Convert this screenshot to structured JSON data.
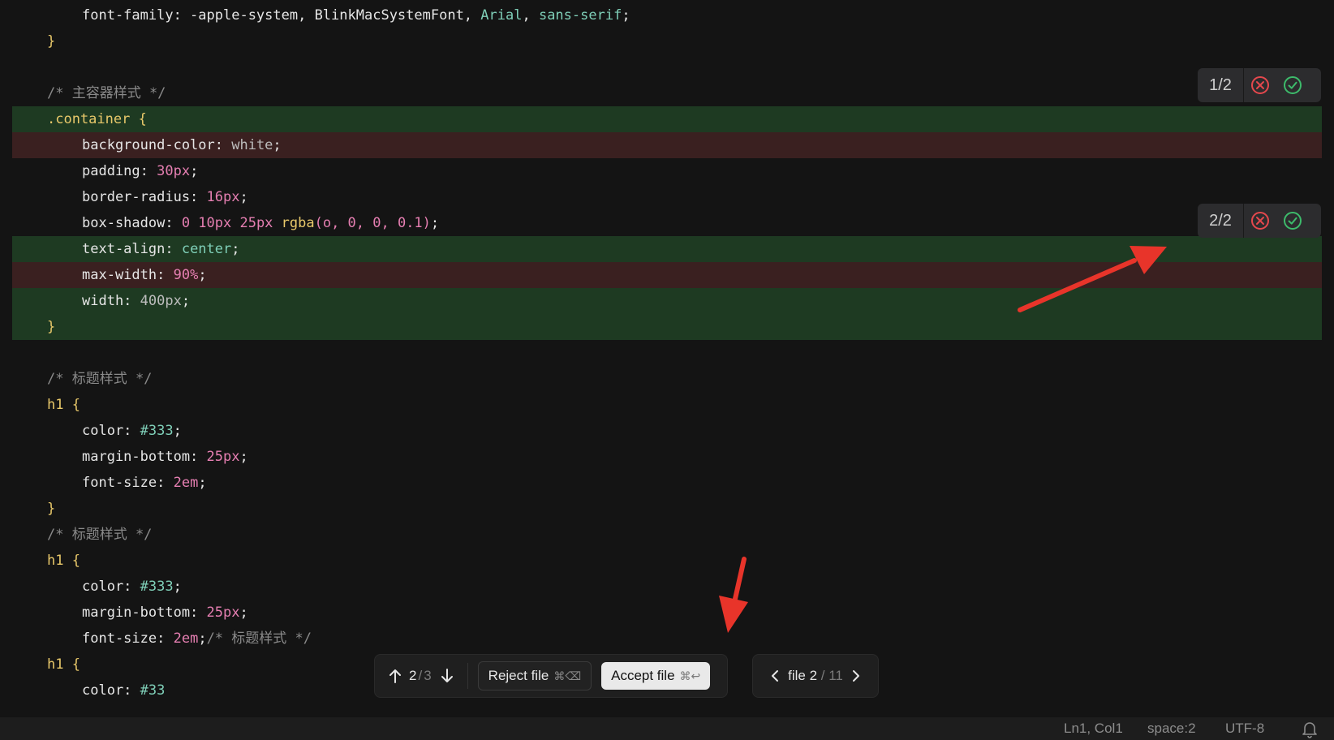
{
  "editor": {
    "lines": [
      {
        "diff": "none",
        "indent": 1,
        "tokens": [
          {
            "t": "font-family: -apple-system, BlinkMacSystemFont, ",
            "c": "prop"
          },
          {
            "t": "Arial",
            "c": "teal"
          },
          {
            "t": ", ",
            "c": "prop"
          },
          {
            "t": "sans-serif",
            "c": "teal"
          },
          {
            "t": ";",
            "c": "prop"
          }
        ]
      },
      {
        "diff": "none",
        "indent": 0,
        "tokens": [
          {
            "t": "}",
            "c": "yellow"
          }
        ]
      },
      {
        "diff": "none",
        "indent": 0,
        "tokens": []
      },
      {
        "diff": "none",
        "indent": 0,
        "tokens": [
          {
            "t": "/* 主容器样式 */",
            "c": "comment"
          }
        ]
      },
      {
        "diff": "added",
        "indent": 0,
        "tokens": [
          {
            "t": ".container {",
            "c": "sel"
          }
        ]
      },
      {
        "diff": "removed",
        "indent": 1,
        "tokens": [
          {
            "t": "background-color: ",
            "c": "prop"
          },
          {
            "t": "white",
            "c": "gray"
          },
          {
            "t": ";",
            "c": "prop"
          }
        ]
      },
      {
        "diff": "none",
        "indent": 1,
        "tokens": [
          {
            "t": "padding: ",
            "c": "prop"
          },
          {
            "t": "30px",
            "c": "pink"
          },
          {
            "t": ";",
            "c": "prop"
          }
        ]
      },
      {
        "diff": "none",
        "indent": 1,
        "tokens": [
          {
            "t": "border-radius: ",
            "c": "prop"
          },
          {
            "t": "16px",
            "c": "pink"
          },
          {
            "t": ";",
            "c": "prop"
          }
        ]
      },
      {
        "diff": "none",
        "indent": 1,
        "tokens": [
          {
            "t": "box-shadow: ",
            "c": "prop"
          },
          {
            "t": "0 10px 25px ",
            "c": "pink"
          },
          {
            "t": "rgba",
            "c": "yellow"
          },
          {
            "t": "(o, 0, 0, 0.1)",
            "c": "pink"
          },
          {
            "t": ";",
            "c": "prop"
          }
        ]
      },
      {
        "diff": "added",
        "indent": 1,
        "tokens": [
          {
            "t": "text-align: ",
            "c": "prop"
          },
          {
            "t": "center",
            "c": "teal"
          },
          {
            "t": ";",
            "c": "prop"
          }
        ]
      },
      {
        "diff": "removed",
        "indent": 1,
        "tokens": [
          {
            "t": "max-width: ",
            "c": "prop"
          },
          {
            "t": "90%",
            "c": "pink"
          },
          {
            "t": ";",
            "c": "prop"
          }
        ]
      },
      {
        "diff": "added",
        "indent": 1,
        "tokens": [
          {
            "t": "width: ",
            "c": "prop"
          },
          {
            "t": "400px",
            "c": "gray"
          },
          {
            "t": ";",
            "c": "prop"
          }
        ]
      },
      {
        "diff": "added",
        "indent": 0,
        "tokens": [
          {
            "t": "}",
            "c": "yellow"
          }
        ]
      },
      {
        "diff": "none",
        "indent": 0,
        "tokens": []
      },
      {
        "diff": "none",
        "indent": 0,
        "tokens": [
          {
            "t": "/* 标题样式 */",
            "c": "comment"
          }
        ]
      },
      {
        "diff": "none",
        "indent": 0,
        "tokens": [
          {
            "t": "h1 {",
            "c": "sel"
          }
        ]
      },
      {
        "diff": "none",
        "indent": 1,
        "tokens": [
          {
            "t": "color: ",
            "c": "prop"
          },
          {
            "t": "#333",
            "c": "teal"
          },
          {
            "t": ";",
            "c": "prop"
          }
        ]
      },
      {
        "diff": "none",
        "indent": 1,
        "tokens": [
          {
            "t": "margin-bottom: ",
            "c": "prop"
          },
          {
            "t": "25px",
            "c": "pink"
          },
          {
            "t": ";",
            "c": "prop"
          }
        ]
      },
      {
        "diff": "none",
        "indent": 1,
        "tokens": [
          {
            "t": "font-size: ",
            "c": "prop"
          },
          {
            "t": "2em",
            "c": "pink"
          },
          {
            "t": ";",
            "c": "prop"
          }
        ]
      },
      {
        "diff": "none",
        "indent": 0,
        "tokens": [
          {
            "t": "}",
            "c": "yellow"
          }
        ]
      },
      {
        "diff": "none",
        "indent": 0,
        "tokens": [
          {
            "t": "/* 标题样式 */",
            "c": "comment"
          }
        ]
      },
      {
        "diff": "none",
        "indent": 0,
        "tokens": [
          {
            "t": "h1 {",
            "c": "sel"
          }
        ]
      },
      {
        "diff": "none",
        "indent": 1,
        "tokens": [
          {
            "t": "color: ",
            "c": "prop"
          },
          {
            "t": "#333",
            "c": "teal"
          },
          {
            "t": ";",
            "c": "prop"
          }
        ]
      },
      {
        "diff": "none",
        "indent": 1,
        "tokens": [
          {
            "t": "margin-bottom: ",
            "c": "prop"
          },
          {
            "t": "25px",
            "c": "pink"
          },
          {
            "t": ";",
            "c": "prop"
          }
        ]
      },
      {
        "diff": "none",
        "indent": 1,
        "tokens": [
          {
            "t": "font-size: ",
            "c": "prop"
          },
          {
            "t": "2em",
            "c": "pink"
          },
          {
            "t": ";",
            "c": "prop"
          },
          {
            "t": "/* 标题样式 */",
            "c": "comment"
          }
        ]
      },
      {
        "diff": "none",
        "indent": 0,
        "tokens": [
          {
            "t": "h1 {",
            "c": "sel"
          }
        ]
      },
      {
        "diff": "none",
        "indent": 1,
        "tokens": [
          {
            "t": "color: ",
            "c": "prop"
          },
          {
            "t": "#33",
            "c": "teal"
          }
        ]
      }
    ]
  },
  "hunks": [
    {
      "label": "1/2"
    },
    {
      "label": "2/2"
    }
  ],
  "toolbar": {
    "change_current": "2",
    "change_sep": "/",
    "change_total": "3",
    "reject_label": "Reject file",
    "reject_shortcut": "⌘⌫",
    "accept_label": "Accept file",
    "accept_shortcut": "⌘↩"
  },
  "filenav": {
    "prefix": "file 2",
    "sep": "/",
    "total": "11"
  },
  "status": {
    "position": "Ln1, Col1",
    "indent": "space:2",
    "encoding": "UTF-8"
  },
  "colors": {
    "added_bg": "#1e3a22",
    "removed_bg": "#3a2020",
    "reject_icon": "#e5484d",
    "accept_icon": "#3dbb6b",
    "annotation_arrow": "#e8342a"
  }
}
